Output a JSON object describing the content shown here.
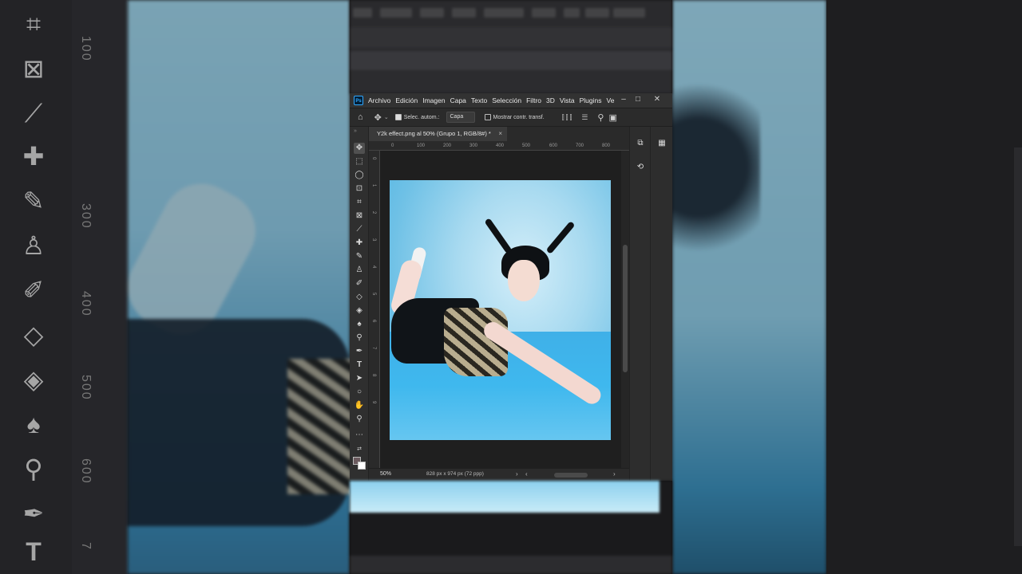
{
  "app": {
    "logo_text": "Ps",
    "menu": [
      "Archivo",
      "Edición",
      "Imagen",
      "Capa",
      "Texto",
      "Selección",
      "Filtro",
      "3D",
      "Vista",
      "Plugins",
      "Ve"
    ]
  },
  "window_controls": {
    "minimize": "–",
    "maximize": "□",
    "close": "✕"
  },
  "options_bar": {
    "auto_select_label": "Selec. autom.:",
    "auto_select_checked": true,
    "target_select": "Capa",
    "show_transform_label": "Mostrar contr. transf.",
    "show_transform_checked": false
  },
  "document_tab": {
    "title": "Y2k effect.png al 50% (Grupo 1, RGB/8#) *",
    "close": "×"
  },
  "ruler_top_ticks": [
    "0",
    "100",
    "200",
    "300",
    "400",
    "500",
    "600",
    "700",
    "800"
  ],
  "ruler_left_ticks": [
    "0",
    "1",
    "2",
    "3",
    "4",
    "5",
    "6",
    "7",
    "8",
    "9"
  ],
  "status_bar": {
    "zoom": "50%",
    "doc_info": "828 px x 974 px (72 ppp)"
  },
  "background_ruler_ticks": [
    "100",
    "300",
    "400",
    "500",
    "600",
    "7"
  ],
  "colors": {
    "accent": "#31a8ff",
    "ui_dark": "#323232",
    "canvas_bg": "#1f1f1f"
  }
}
